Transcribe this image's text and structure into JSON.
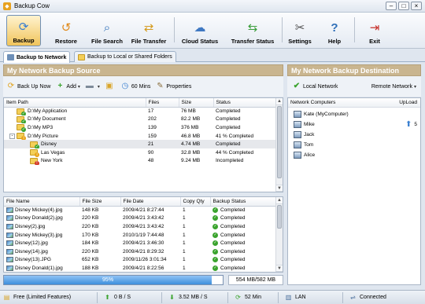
{
  "window": {
    "title": "Backup Cow"
  },
  "toolbar": [
    {
      "label": "Backup",
      "icon": "backup-icon",
      "glyph": "⟳",
      "color": "#3a7fd0",
      "active": true
    },
    {
      "label": "Restore",
      "icon": "restore-icon",
      "glyph": "↺",
      "color": "#e08a1c"
    },
    {
      "label": "File Search",
      "icon": "search-icon",
      "glyph": "⌕",
      "color": "#2f6fb8"
    },
    {
      "label": "File Transfer",
      "icon": "transfer-icon",
      "glyph": "⇄",
      "color": "#d59b1e"
    },
    {
      "label": "Cloud Status",
      "icon": "cloud-icon",
      "glyph": "☁",
      "color": "#3f78c2"
    },
    {
      "label": "Transfer Status",
      "icon": "transfer-status-icon",
      "glyph": "⇆",
      "color": "#3a9d3a"
    },
    {
      "label": "Settings",
      "icon": "settings-icon",
      "glyph": "✂",
      "color": "#555"
    },
    {
      "label": "Help",
      "icon": "help-icon",
      "glyph": "?",
      "color": "#2f6fb8"
    },
    {
      "label": "Exit",
      "icon": "exit-icon",
      "glyph": "⇥",
      "color": "#c7322c"
    }
  ],
  "tabs": [
    {
      "label": "Backup to Network",
      "active": true
    },
    {
      "label": "Backup to Local or Shared Folders",
      "active": false
    }
  ],
  "source": {
    "header": "My Network Backup Source",
    "actions": {
      "backup_now": "Back Up Now",
      "add": "Add",
      "interval": "60 Mins",
      "properties": "Properties"
    },
    "columns": [
      "Item Path",
      "Files",
      "Size",
      "Status"
    ],
    "items": [
      {
        "path": "D:\\My Application",
        "files": "17",
        "size": "76 MB",
        "status": "Completed",
        "badge": "ok",
        "level": 0,
        "clipped": true
      },
      {
        "path": "D:\\My Document",
        "files": "202",
        "size": "82.2 MB",
        "status": "Completed",
        "badge": "ok",
        "level": 0
      },
      {
        "path": "D:\\My MP3",
        "files": "139",
        "size": "376 MB",
        "status": "Completed",
        "badge": "ok",
        "level": 0
      },
      {
        "path": "D:\\My Picture",
        "files": "159",
        "size": "46.8 MB",
        "status": "41 % Completed",
        "badge": "warn",
        "level": 0,
        "expand": "-"
      },
      {
        "path": "Disney",
        "files": "21",
        "size": "4.74 MB",
        "status": "Completed",
        "badge": "ok",
        "level": 1,
        "selected": true
      },
      {
        "path": "Las Vegas",
        "files": "90",
        "size": "32.8 MB",
        "status": "44 % Completed",
        "badge": "warn",
        "level": 1
      },
      {
        "path": "New York",
        "files": "48",
        "size": "9.24 MB",
        "status": "Incompleted",
        "badge": "err",
        "level": 1
      }
    ]
  },
  "files": {
    "columns": [
      "File Name",
      "File Size",
      "File Date",
      "Copy Qty",
      "Backup Status"
    ],
    "rows": [
      {
        "name": "Disney Mickey(4).jpg",
        "size": "148 KB",
        "date": "2009/4/21 8:27:44",
        "qty": "1",
        "status": "Completed"
      },
      {
        "name": "Disney Donald(2).jpg",
        "size": "220 KB",
        "date": "2009/4/21 3:43:42",
        "qty": "1",
        "status": "Completed"
      },
      {
        "name": "Disney(2).jpg",
        "size": "220 KB",
        "date": "2009/4/21 3:43:42",
        "qty": "1",
        "status": "Completed"
      },
      {
        "name": "Disney Mickey(3).jpg",
        "size": "170 KB",
        "date": "2010/1/19 7:44:48",
        "qty": "1",
        "status": "Completed"
      },
      {
        "name": "Disney(12).jpg",
        "size": "184 KB",
        "date": "2009/4/21 3:46:30",
        "qty": "1",
        "status": "Completed"
      },
      {
        "name": "Disney(14).jpg",
        "size": "220 KB",
        "date": "2009/4/21 8:29:32",
        "qty": "1",
        "status": "Completed"
      },
      {
        "name": "Disney(13).JPG",
        "size": "652 KB",
        "date": "2009/11/26 3:01:34",
        "qty": "1",
        "status": "Completed"
      },
      {
        "name": "Disney Donald(1).jpg",
        "size": "188 KB",
        "date": "2009/4/21 8:22:56",
        "qty": "1",
        "status": "Completed",
        "clipped": true
      }
    ],
    "progress": {
      "percent": 95,
      "label": "95%"
    },
    "size_summary": "554 MB/582 MB"
  },
  "destination": {
    "header": "My Network Backup Destination",
    "local_label": "Local Network",
    "remote_label": "Remote Network",
    "columns": [
      "Network Computers",
      "UpLoad"
    ],
    "computers": [
      {
        "name": "Kate (MyComputer)",
        "upload": ""
      },
      {
        "name": "Mike",
        "upload": "5"
      },
      {
        "name": "Jack",
        "upload": ""
      },
      {
        "name": "Tom",
        "upload": ""
      },
      {
        "name": "Alice",
        "upload": ""
      }
    ]
  },
  "statusbar": {
    "edition": "Free (Limited Features)",
    "up_speed": "0 B / S",
    "down_speed": "3.52 MB / S",
    "interval": "52 Min",
    "network": "LAN",
    "connection": "Connected"
  }
}
